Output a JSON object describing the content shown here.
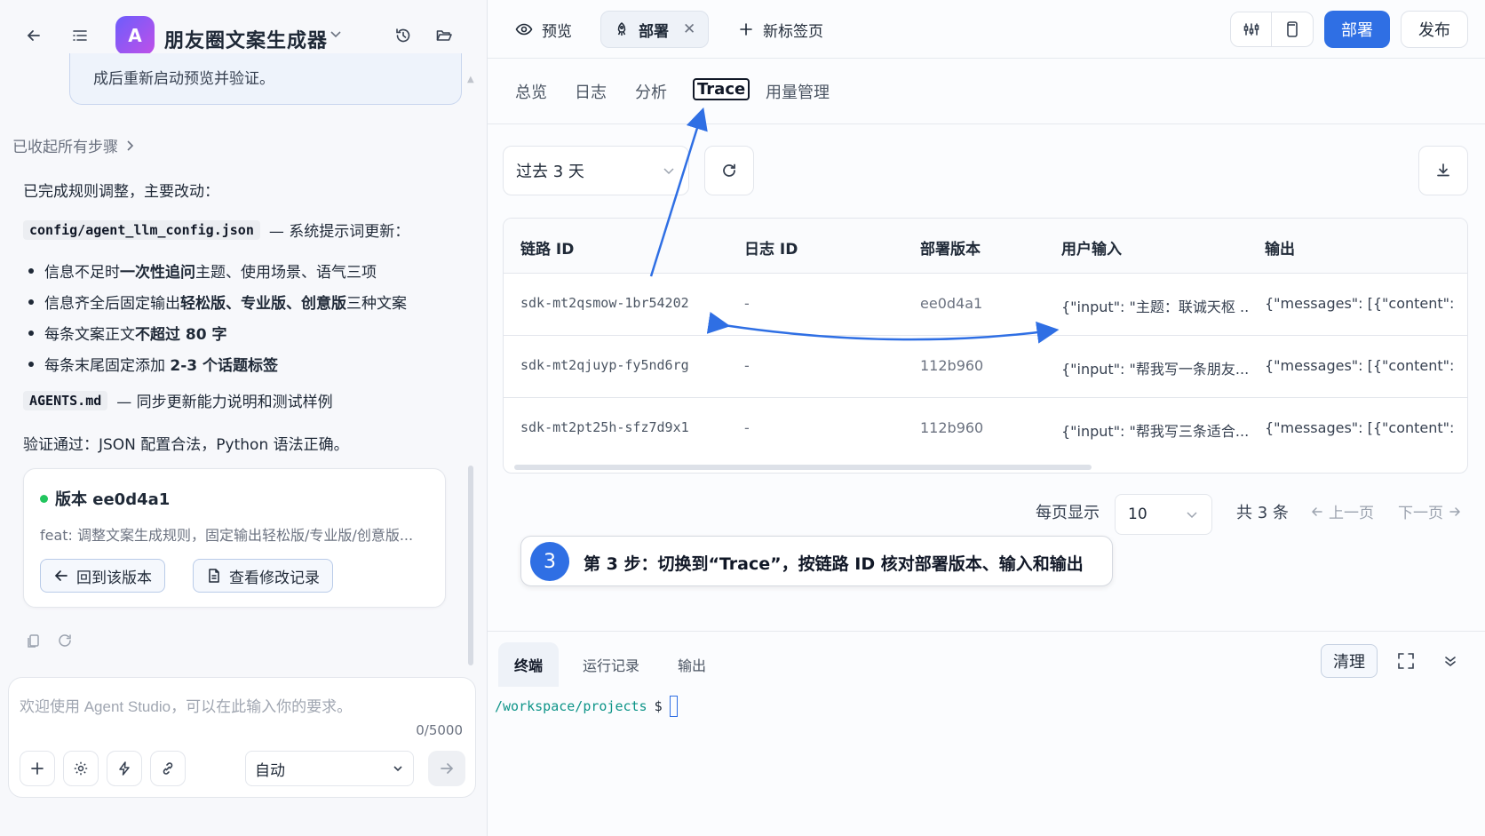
{
  "app": {
    "avatar_letter": "A",
    "title": "朋友圈文案生成器",
    "avatar_gradient": [
      "#6d5dfc",
      "#c050e8"
    ]
  },
  "chat": {
    "notice_text": "成后重新启动预览并验证。",
    "collapsed_steps": "已收起所有步骤",
    "intro": "已完成规则调整，主要改动：",
    "file1": {
      "name": "config/agent_llm_config.json",
      "desc": "— 系统提示词更新："
    },
    "bullets": [
      {
        "pre": "信息不足时",
        "bold": "一次性追问",
        "post": "主题、使用场景、语气三项"
      },
      {
        "pre": "信息齐全后固定输出",
        "bold": "轻松版、专业版、创意版",
        "post": "三种文案"
      },
      {
        "pre": "每条文案正文",
        "bold": "不超过 80 字",
        "post": ""
      },
      {
        "pre": "每条末尾固定添加 ",
        "bold": "2-3 个话题标签",
        "post": ""
      }
    ],
    "file2": {
      "name": "AGENTS.md",
      "desc": "— 同步更新能力说明和测试样例"
    },
    "verify": "验证通过：JSON 配置合法，Python 语法正确。",
    "version_card": {
      "title": "版本 ee0d4a1",
      "desc": "feat: 调整文案生成规则，固定输出轻松版/专业版/创意版...",
      "rollback": "回到该版本",
      "changes": "查看修改记录",
      "status_color": "#22c55e"
    }
  },
  "input": {
    "placeholder": "欢迎使用 Agent Studio，可以在此输入你的要求。",
    "counter": "0/5000",
    "mode": "自动"
  },
  "topbar": {
    "tabs": [
      {
        "label": "预览",
        "icon": "eye-icon"
      },
      {
        "label": "部署",
        "icon": "rocket-icon",
        "active": true
      },
      {
        "label": "新标签页",
        "icon": "plus-icon"
      }
    ],
    "deploy_label": "部署",
    "publish_label": "发布",
    "accent": "#2f6fe4"
  },
  "subtabs": [
    "总览",
    "日志",
    "分析",
    "Trace",
    "用量管理"
  ],
  "filters": {
    "range": "过去 3 天"
  },
  "table": {
    "headers": [
      "链路 ID",
      "日志 ID",
      "部署版本",
      "用户输入",
      "输出"
    ],
    "rows": [
      [
        "sdk-mt2qsmow-1br54202",
        "-",
        "ee0d4a1",
        "{\"input\": \"主题：联诚天枢 ...",
        "{\"messages\": [{\"content\": \"..."
      ],
      [
        "sdk-mt2qjuyp-fy5nd6rg",
        "-",
        "112b960",
        "{\"input\": \"帮我写一条朋友...",
        "{\"messages\": [{\"content\": \"..."
      ],
      [
        "sdk-mt2pt25h-sfz7d9x1",
        "-",
        "112b960",
        "{\"input\": \"帮我写三条适合...",
        "{\"messages\": [{\"content\": \"..."
      ]
    ]
  },
  "pagination": {
    "per_page_label": "每页显示",
    "per_page": "10",
    "total": "共 3 条",
    "prev": "上一页",
    "next": "下一页"
  },
  "callout": {
    "step": "3",
    "text": "第 3 步：切换到“Trace”，按链路 ID 核对部署版本、输入和输出"
  },
  "terminal": {
    "tabs": [
      "终端",
      "运行记录",
      "输出"
    ],
    "clear": "清理",
    "path": "/workspace/projects",
    "prompt_symbol": "$"
  }
}
